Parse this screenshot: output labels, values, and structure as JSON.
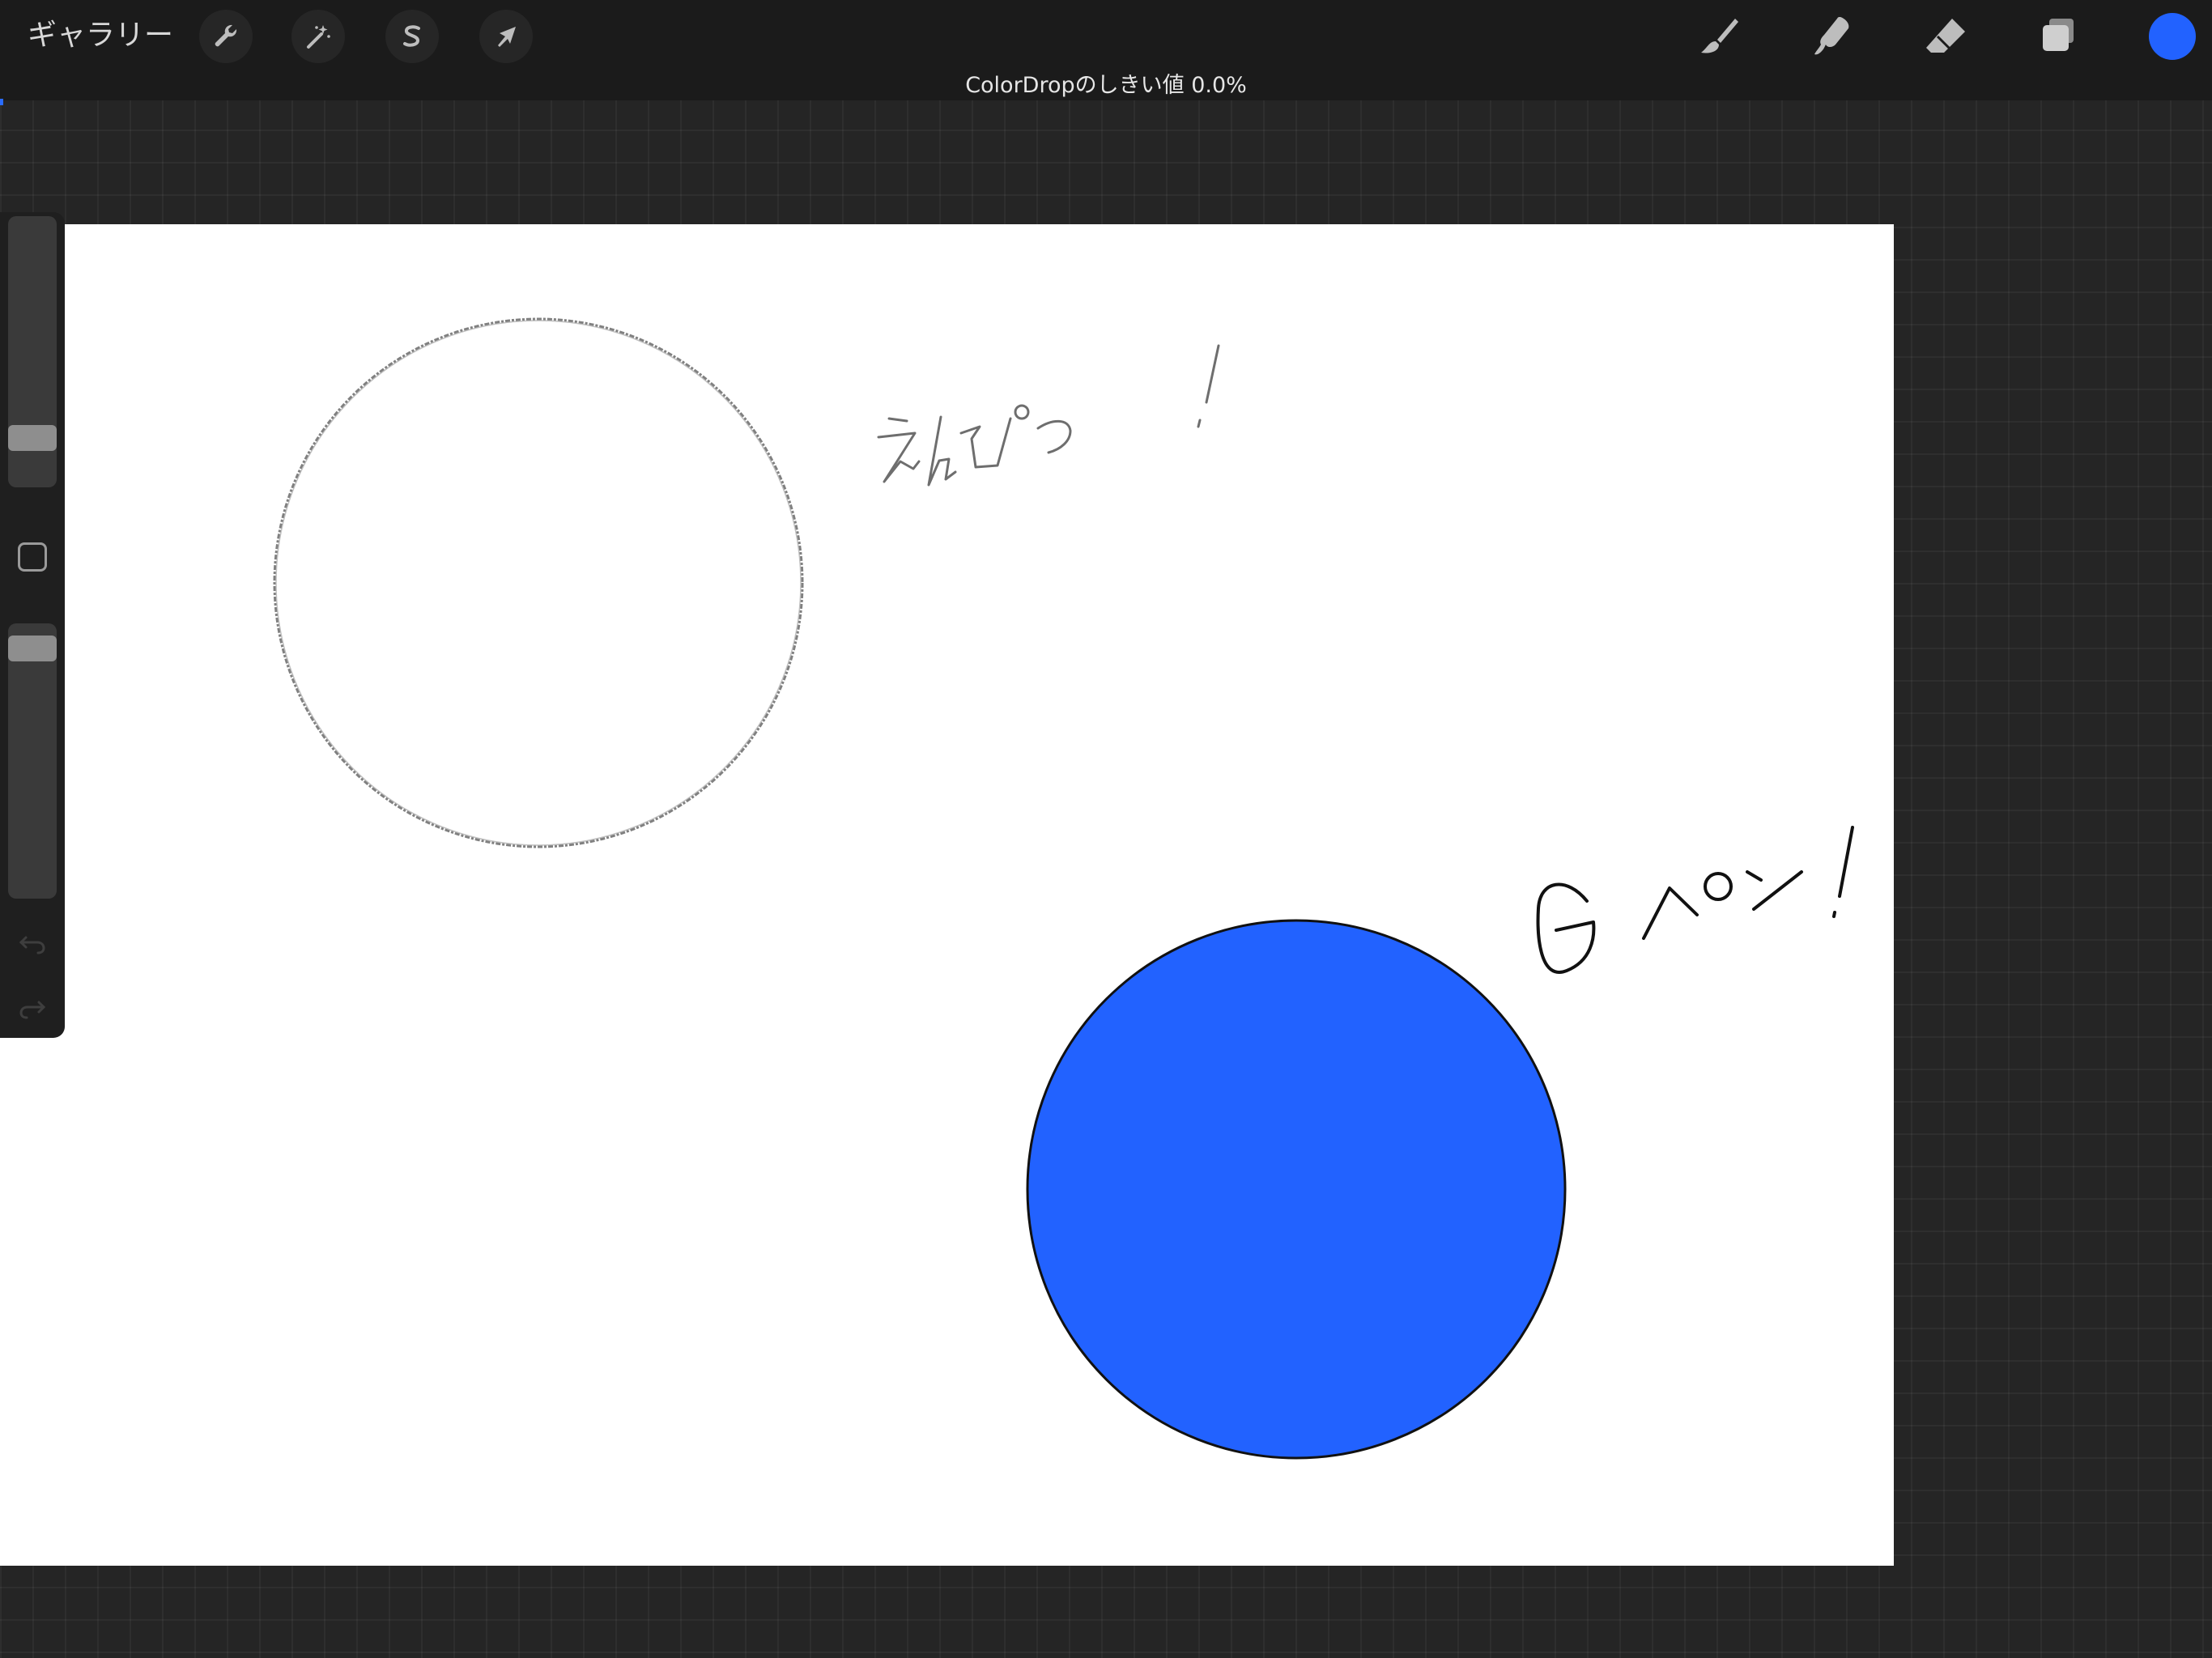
{
  "toolbar": {
    "gallery_label": "ギャラリー",
    "left_tools": [
      {
        "name": "actions",
        "icon": "wrench-icon"
      },
      {
        "name": "adjustments",
        "icon": "magic-wand-icon"
      },
      {
        "name": "selection",
        "icon": "selection-s-icon"
      },
      {
        "name": "transform",
        "icon": "arrow-cursor-icon"
      }
    ],
    "right_tools": [
      {
        "name": "brush",
        "icon": "brush-icon"
      },
      {
        "name": "smudge",
        "icon": "smudge-icon"
      },
      {
        "name": "eraser",
        "icon": "eraser-icon"
      },
      {
        "name": "layers",
        "icon": "layers-icon"
      }
    ],
    "current_color": "#2262ff"
  },
  "status": {
    "message": "ColorDropのしきい値 0.0%"
  },
  "sidebar": {
    "brush_size_level": 0.15,
    "opacity_level": 0.95,
    "modify_icon": "square-icon",
    "undo_icon": "undo-icon",
    "redo_icon": "redo-icon"
  },
  "canvas": {
    "background": "#ffffff",
    "fill_color": "#2262ff",
    "pencil_label": "えんぴつ！",
    "gpen_label": "Gペン！"
  }
}
